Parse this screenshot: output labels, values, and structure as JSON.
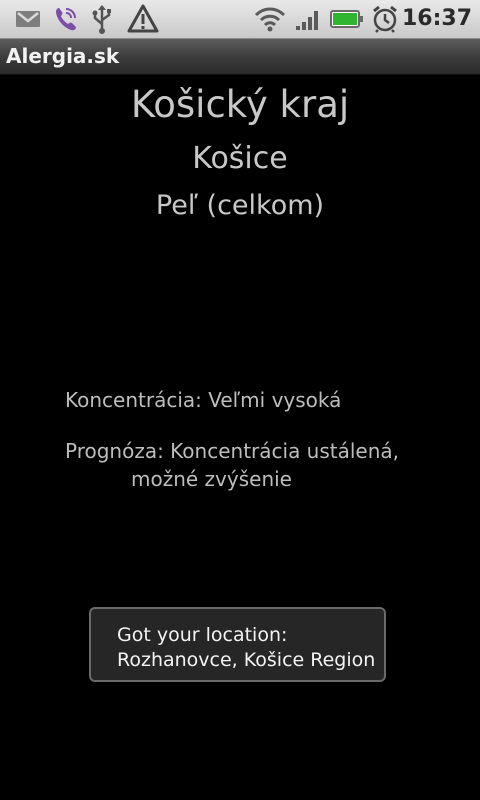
{
  "statusbar": {
    "icons": [
      "gmail-icon",
      "viber-icon",
      "usb-icon",
      "warning-icon",
      "wifi-icon",
      "signal-icon",
      "battery-icon",
      "alarm-icon"
    ],
    "time": "16:37",
    "battery_color": "#2fb52f"
  },
  "app": {
    "title": "Alergia.sk"
  },
  "main": {
    "region": "Košický kraj",
    "city": "Košice",
    "pollen_type": "Peľ (celkom)",
    "concentration": "Koncentrácia: Veľmi vysoká",
    "forecast_line1": "Prognóza: Koncentrácia ustálená,",
    "forecast_line2": "možné zvýšenie"
  },
  "toast": {
    "line1": "Got your location:",
    "line2": "Rozhanovce, Košice Region"
  }
}
